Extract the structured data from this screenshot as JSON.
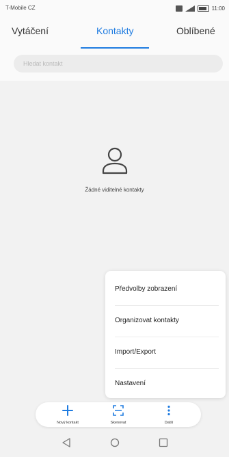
{
  "status_bar": {
    "carrier": "T-Mobile CZ",
    "time": "11:00"
  },
  "tabs": [
    {
      "label": "Vytáčení",
      "active": false
    },
    {
      "label": "Kontakty",
      "active": true
    },
    {
      "label": "Oblíbené",
      "active": false
    }
  ],
  "accent_color": "#1e7be0",
  "search": {
    "placeholder": "Hledat kontakt"
  },
  "empty_state": {
    "icon": "person-icon",
    "text": "Žádné viditelné kontakty"
  },
  "menu": {
    "items": [
      {
        "label": "Předvolby zobrazení"
      },
      {
        "label": "Organizovat kontakty"
      },
      {
        "label": "Import/Export"
      },
      {
        "label": "Nastavení"
      }
    ]
  },
  "actions": [
    {
      "label": "Nový kontakt",
      "icon": "plus-icon"
    },
    {
      "label": "Skenovat",
      "icon": "scan-icon"
    },
    {
      "label": "Další",
      "icon": "more-vertical-icon"
    }
  ],
  "navigation": {
    "icons": [
      "back-icon",
      "home-icon",
      "recents-icon"
    ]
  }
}
